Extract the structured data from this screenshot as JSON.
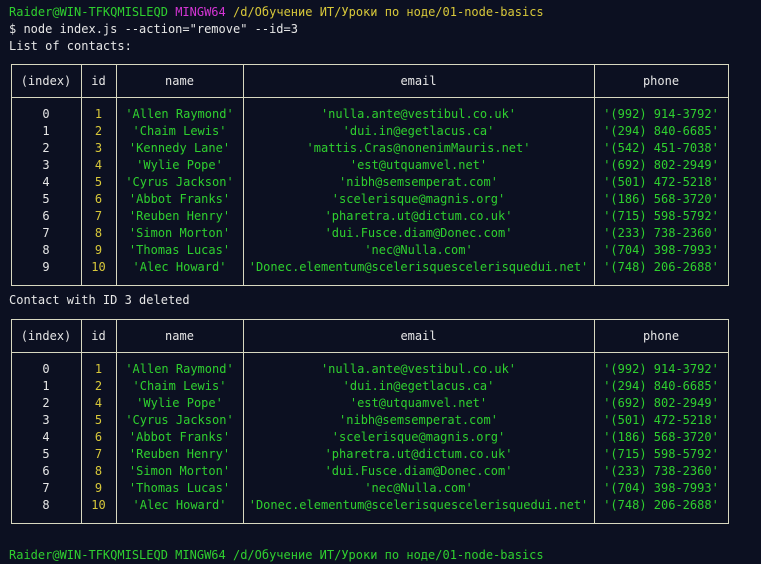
{
  "prompt": {
    "user_host": "Raider@WIN-TFKQMISLEQD",
    "shell": "MINGW64",
    "cwd": "/d/Обучение ИТ/Уроки по ноде/01-node-basics"
  },
  "command": "$ node index.js --action=\"remove\" --id=3",
  "list_title": "List of contacts:",
  "deleted_msg": "Contact with ID 3 deleted",
  "columns": [
    "(index)",
    "id",
    "name",
    "email",
    "phone"
  ],
  "table1": [
    [
      "0",
      "1",
      "'Allen Raymond'",
      "'nulla.ante@vestibul.co.uk'",
      "'(992) 914-3792'"
    ],
    [
      "1",
      "2",
      "'Chaim Lewis'",
      "'dui.in@egetlacus.ca'",
      "'(294) 840-6685'"
    ],
    [
      "2",
      "3",
      "'Kennedy Lane'",
      "'mattis.Cras@nonenimMauris.net'",
      "'(542) 451-7038'"
    ],
    [
      "3",
      "4",
      "'Wylie Pope'",
      "'est@utquamvel.net'",
      "'(692) 802-2949'"
    ],
    [
      "4",
      "5",
      "'Cyrus Jackson'",
      "'nibh@semsemperat.com'",
      "'(501) 472-5218'"
    ],
    [
      "5",
      "6",
      "'Abbot Franks'",
      "'scelerisque@magnis.org'",
      "'(186) 568-3720'"
    ],
    [
      "6",
      "7",
      "'Reuben Henry'",
      "'pharetra.ut@dictum.co.uk'",
      "'(715) 598-5792'"
    ],
    [
      "7",
      "8",
      "'Simon Morton'",
      "'dui.Fusce.diam@Donec.com'",
      "'(233) 738-2360'"
    ],
    [
      "8",
      "9",
      "'Thomas Lucas'",
      "'nec@Nulla.com'",
      "'(704) 398-7993'"
    ],
    [
      "9",
      "10",
      "'Alec Howard'",
      "'Donec.elementum@scelerisquescelerisquedui.net'",
      "'(748) 206-2688'"
    ]
  ],
  "table2": [
    [
      "0",
      "1",
      "'Allen Raymond'",
      "'nulla.ante@vestibul.co.uk'",
      "'(992) 914-3792'"
    ],
    [
      "1",
      "2",
      "'Chaim Lewis'",
      "'dui.in@egetlacus.ca'",
      "'(294) 840-6685'"
    ],
    [
      "2",
      "4",
      "'Wylie Pope'",
      "'est@utquamvel.net'",
      "'(692) 802-2949'"
    ],
    [
      "3",
      "5",
      "'Cyrus Jackson'",
      "'nibh@semsemperat.com'",
      "'(501) 472-5218'"
    ],
    [
      "4",
      "6",
      "'Abbot Franks'",
      "'scelerisque@magnis.org'",
      "'(186) 568-3720'"
    ],
    [
      "5",
      "7",
      "'Reuben Henry'",
      "'pharetra.ut@dictum.co.uk'",
      "'(715) 598-5792'"
    ],
    [
      "6",
      "8",
      "'Simon Morton'",
      "'dui.Fusce.diam@Donec.com'",
      "'(233) 738-2360'"
    ],
    [
      "7",
      "9",
      "'Thomas Lucas'",
      "'nec@Nulla.com'",
      "'(704) 398-7993'"
    ],
    [
      "8",
      "10",
      "'Alec Howard'",
      "'Donec.elementum@scelerisquescelerisquedui.net'",
      "'(748) 206-2688'"
    ]
  ],
  "trailing_prompt": "Raider@WIN-TFKQMISLEQD MINGW64 /d/Обучение ИТ/Уроки по ноде/01-node-basics",
  "colors": {
    "background": "#0c1021",
    "green": "#2fd02f",
    "magenta": "#d435d4",
    "yellow": "#d8c83a",
    "text": "#e6e6e6",
    "border": "#d8d8c0"
  }
}
